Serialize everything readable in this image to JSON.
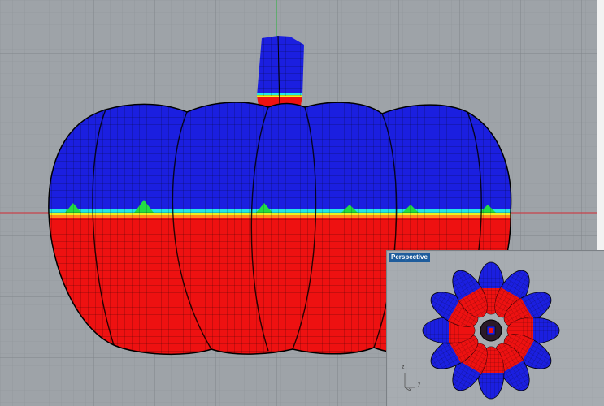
{
  "viewports": {
    "main": {
      "axis_colors": {
        "x": "#c8424a",
        "y": "#3bb14a"
      }
    },
    "inset": {
      "label": "Perspective",
      "axis_x": "x",
      "axis_y": "y",
      "axis_z": "z"
    }
  },
  "colors": {
    "mesh_blue": "#1b1fe0",
    "mesh_red": "#ee1111",
    "band_green": "#22dd44",
    "band_cyan": "#22e6e6",
    "band_yellow": "#e8f020",
    "viewport_bg": "#9ea3a8"
  }
}
